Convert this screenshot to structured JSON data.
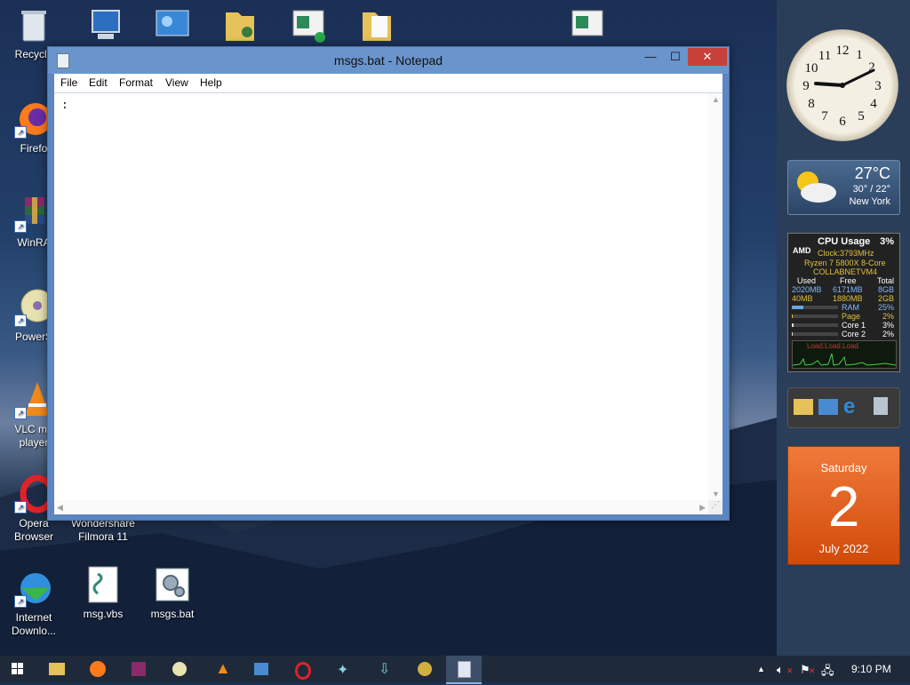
{
  "desktop": {
    "icons": [
      {
        "label": "Recycle"
      },
      {
        "label": "Firefo"
      },
      {
        "label": "WinRA"
      },
      {
        "label": "PowerS"
      },
      {
        "label": "VLC me\nplayer"
      },
      {
        "label": "Opera\nBrowser"
      },
      {
        "label": "Wondershare\nFilmora 11"
      },
      {
        "label": "Internet\nDownlo..."
      },
      {
        "label": "msg.vbs"
      },
      {
        "label": "msgs.bat"
      }
    ]
  },
  "notepad": {
    "title": "msgs.bat - Notepad",
    "menu": [
      "File",
      "Edit",
      "Format",
      "View",
      "Help"
    ],
    "content": ":",
    "min_glyph": "—",
    "max_glyph": "☐",
    "close_glyph": "✕"
  },
  "widgets": {
    "weather": {
      "temp": "27°C",
      "range": "30° / 22°",
      "city": "New York"
    },
    "cpu": {
      "brand": "AMD",
      "title": "CPU Usage",
      "usage": "3%",
      "clock": "Clock:3793MHz",
      "model": "Ryzen 7 5800X 8-Core",
      "host": "COLLABNETVM4",
      "headers": [
        "Used",
        "Free",
        "Total"
      ],
      "rows": [
        [
          "2020MB",
          "6171MB",
          "8GB"
        ],
        [
          "40MB",
          "1880MB",
          "2GB"
        ]
      ],
      "meters": [
        {
          "name": "RAM",
          "value": "25%",
          "fraction": 0.25
        },
        {
          "name": "Page",
          "value": "2%",
          "fraction": 0.02
        },
        {
          "name": "Core 1",
          "value": "3%",
          "fraction": 0.03
        },
        {
          "name": "Core 2",
          "value": "2%",
          "fraction": 0.02
        }
      ],
      "graph_label": "Load.Load.Load"
    },
    "calendar": {
      "weekday": "Saturday",
      "day": "2",
      "month_year": "July 2022"
    }
  },
  "taskbar": {
    "clock": "9:10 PM",
    "tray_up": "▲"
  },
  "colors": {
    "accent": "#5b86c2",
    "close": "#c7413a",
    "calendar": "#e0601e"
  }
}
